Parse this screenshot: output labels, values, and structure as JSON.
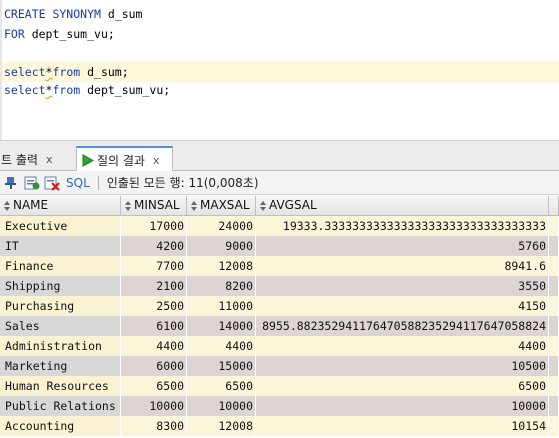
{
  "editor": {
    "lines": [
      [
        {
          "t": "CREATE SYNONYM",
          "kw": true
        },
        {
          "t": " d_sum",
          "kw": false
        }
      ],
      [
        {
          "t": "FOR",
          "kw": true
        },
        {
          "t": " dept_sum_vu;",
          "kw": false
        }
      ],
      [],
      [
        {
          "t": "select",
          "kw": true
        },
        {
          "t": "*",
          "sq": true
        },
        {
          "t": "from",
          "kw": true
        },
        {
          "t": " d_sum;",
          "kw": false
        }
      ],
      [
        {
          "t": "select",
          "kw": true
        },
        {
          "t": "*",
          "sq": true
        },
        {
          "t": "from",
          "kw": true
        },
        {
          "t": " dept_sum_vu;",
          "kw": false
        }
      ]
    ]
  },
  "tabs": {
    "script_output": "립트 출력",
    "query_result": "질의 결과",
    "close": "x"
  },
  "toolbar": {
    "sql_label": "SQL",
    "status": "인출된 모든 행: 11(0,008초)"
  },
  "grid": {
    "columns": [
      "NAME",
      "MINSAL",
      "MAXSAL",
      "AVGSAL"
    ],
    "rows": [
      [
        "Executive",
        "17000",
        "24000",
        "19333.33333333333333333333333333333333"
      ],
      [
        "IT",
        "4200",
        "9000",
        "5760"
      ],
      [
        "Finance",
        "7700",
        "12008",
        "8941.6"
      ],
      [
        "Shipping",
        "2100",
        "8200",
        "3550"
      ],
      [
        "Purchasing",
        "2500",
        "11000",
        "4150"
      ],
      [
        "Sales",
        "6100",
        "14000",
        "8955.882352941176470588235294117647058824"
      ],
      [
        "Administration",
        "4400",
        "4400",
        "4400"
      ],
      [
        "Marketing",
        "6000",
        "15000",
        "10500"
      ],
      [
        "Human Resources",
        "6500",
        "6500",
        "6500"
      ],
      [
        "Public Relations",
        "10000",
        "10000",
        "10000"
      ],
      [
        "Accounting",
        "8300",
        "12008",
        "10154"
      ]
    ]
  }
}
